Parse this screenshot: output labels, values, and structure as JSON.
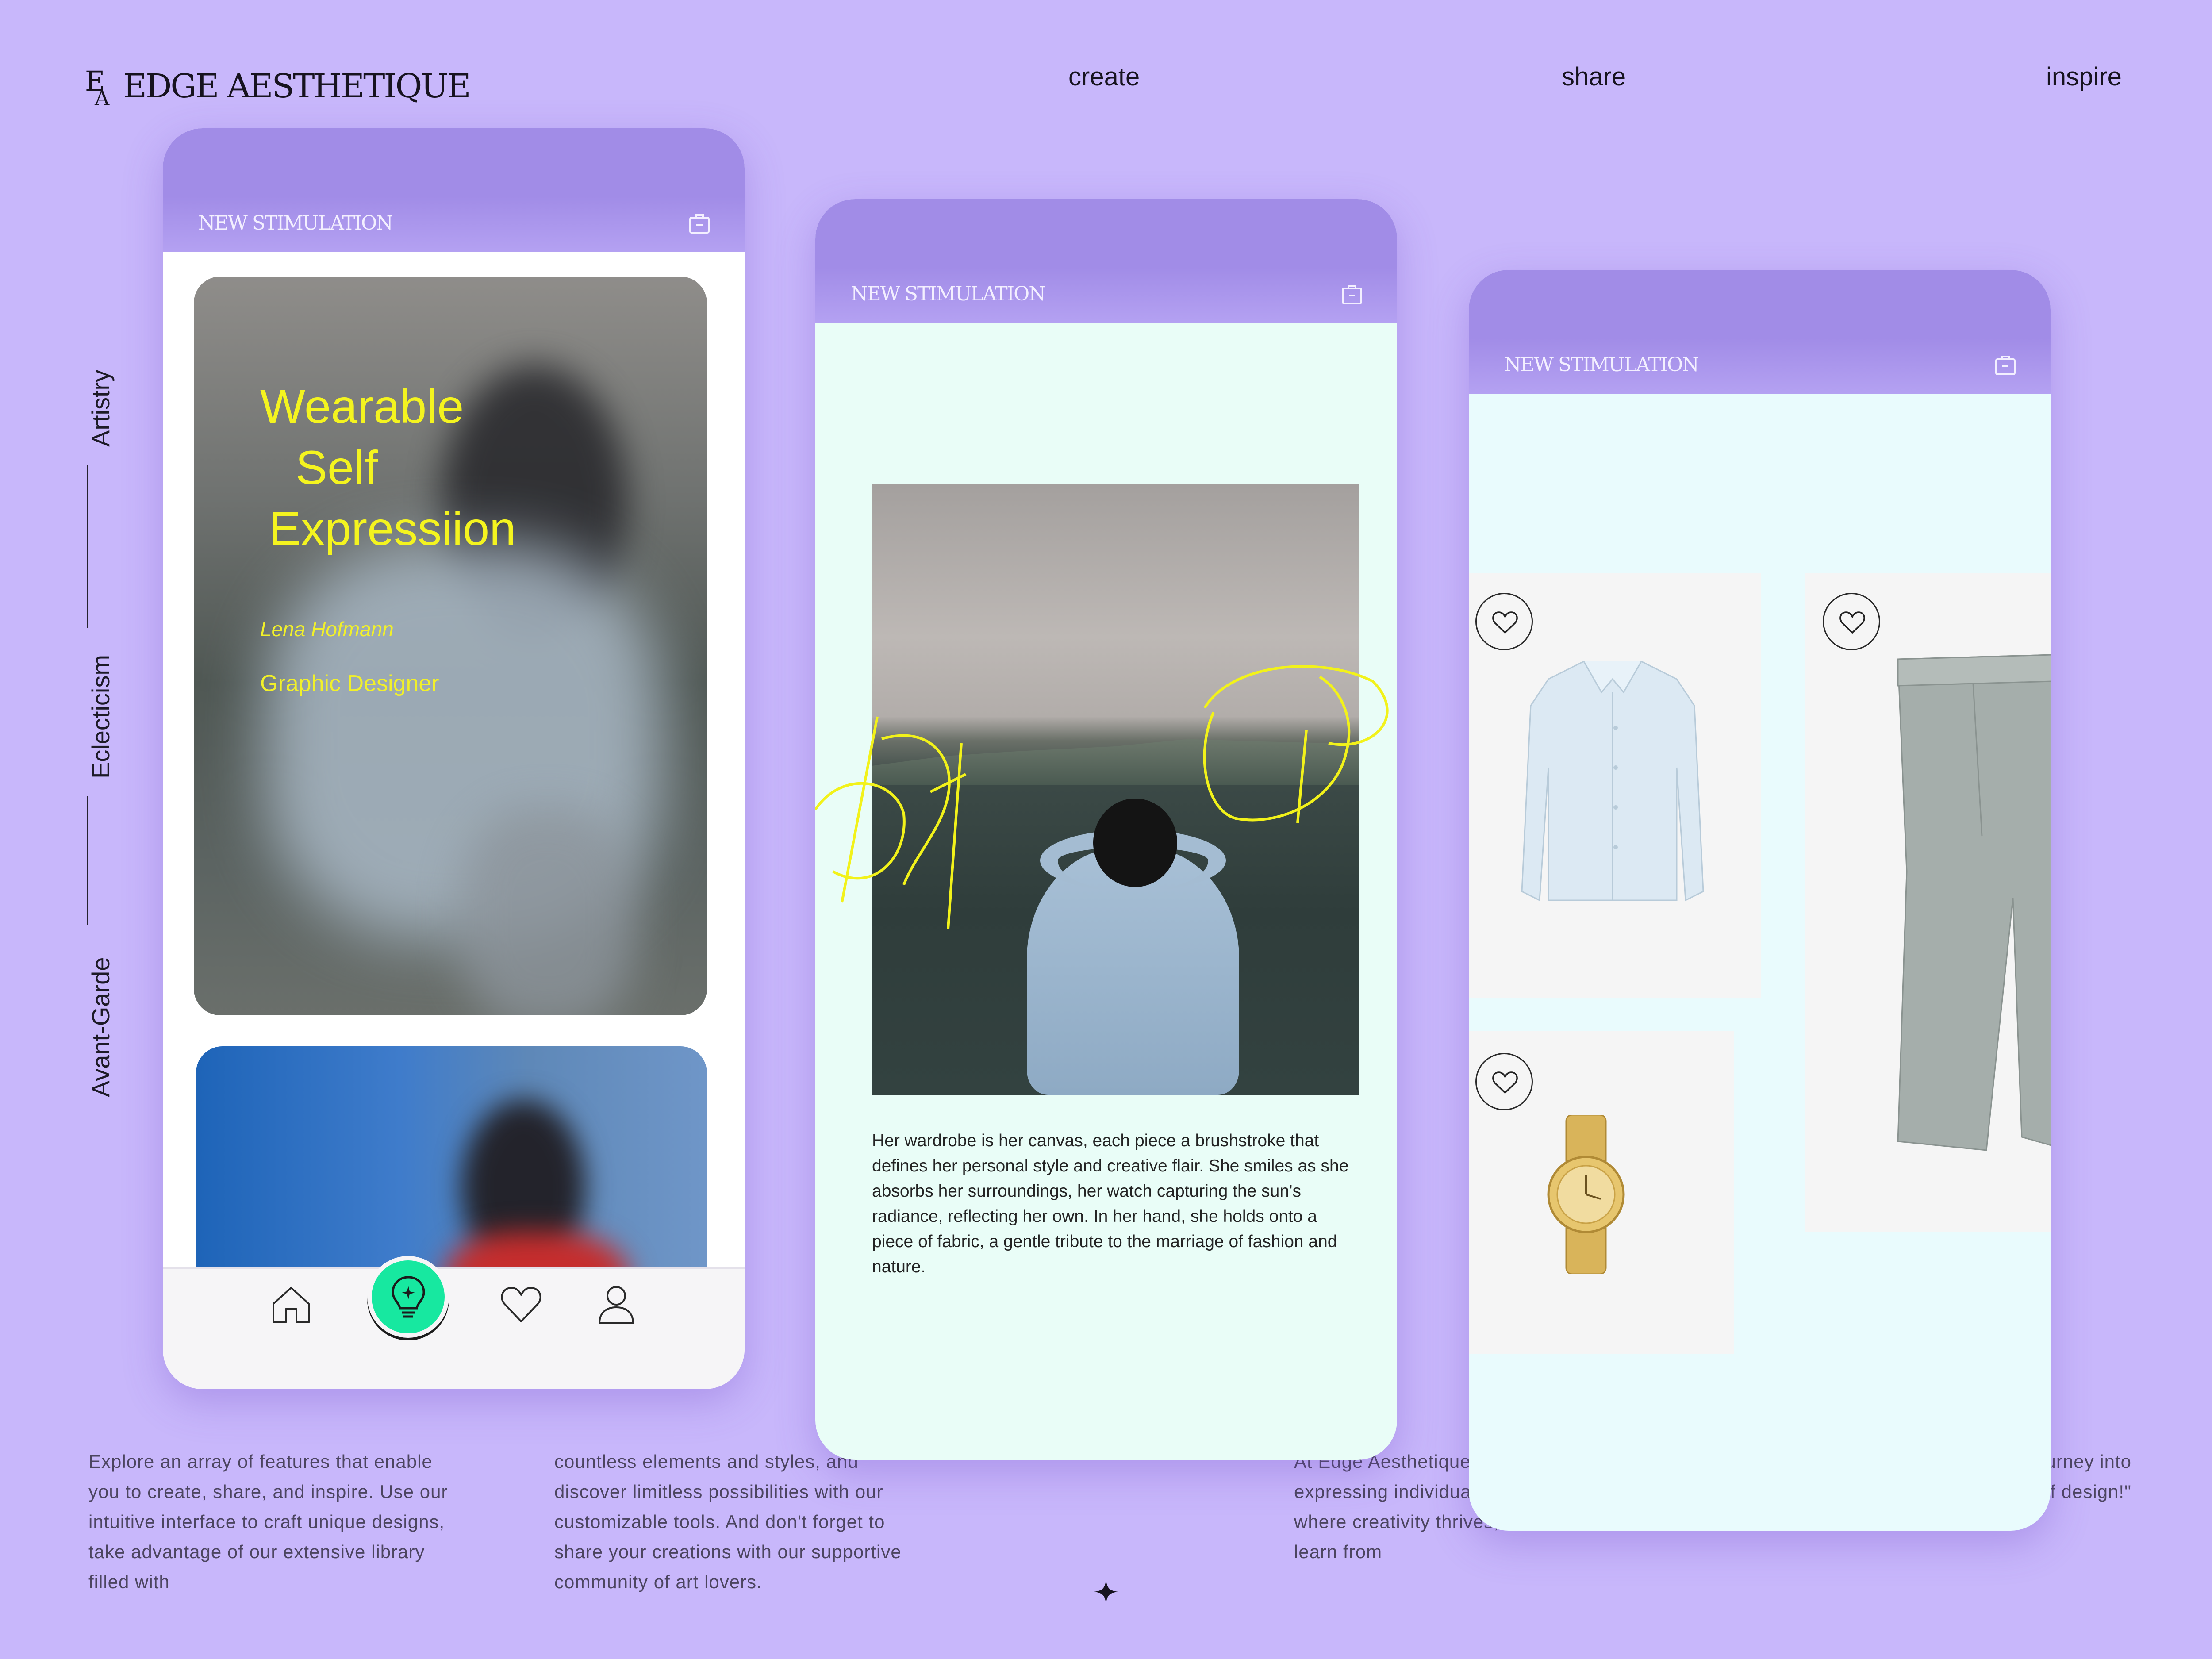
{
  "brand": {
    "name": "EDGE AESTHETIQUE",
    "monogram": "EA"
  },
  "nav": {
    "create": "create",
    "share": "share",
    "inspire": "inspire"
  },
  "side_labels": {
    "artistry": "Artistry",
    "eclecticism": "Eclecticism",
    "avant_garde": "Avant-Garde"
  },
  "phone1": {
    "header_title": "NEW STIMULATION",
    "hero": {
      "line1": "Wearable",
      "line2": "Self",
      "line3": "Expressiion",
      "name": "Lena Hofmann",
      "role": "Graphic Designer"
    },
    "tabbar": [
      "home-icon",
      "lightbulb-icon",
      "heart-icon",
      "user-icon"
    ]
  },
  "phone2": {
    "header_title": "NEW STIMULATION",
    "caption": "Her wardrobe is her canvas, each piece a brushstroke that defines her personal style and creative flair. She smiles as she absorbs her surroundings, her watch capturing the sun's radiance, reflecting her own. In her hand, she holds onto a piece of fabric, a gentle tribute to the marriage of fashion and nature."
  },
  "phone3": {
    "header_title": "NEW STIMULATION",
    "products": [
      "shirt",
      "jeans",
      "watch"
    ]
  },
  "paragraphs": {
    "p1": "Explore an array of features that enable you to create, share, and inspire. Use our intuitive interface to craft unique designs, take advantage of our extensive library filled with",
    "p2": "countless elements and styles, and discover limitless possibilities with our customizable tools. And don't forget to share your creations with our supportive community of art lovers.",
    "p3": "At Edge Aesthetique the importance of expressing individual is to foster a space where creativity thrives, where users can learn from",
    "p4": "mes with today and start your journey into the world of design!\""
  },
  "colors": {
    "background": "#c8b7fb",
    "topbar": "#a18ce7",
    "accent_yellow": "#f4f41f",
    "accent_green": "#17e8a0"
  }
}
